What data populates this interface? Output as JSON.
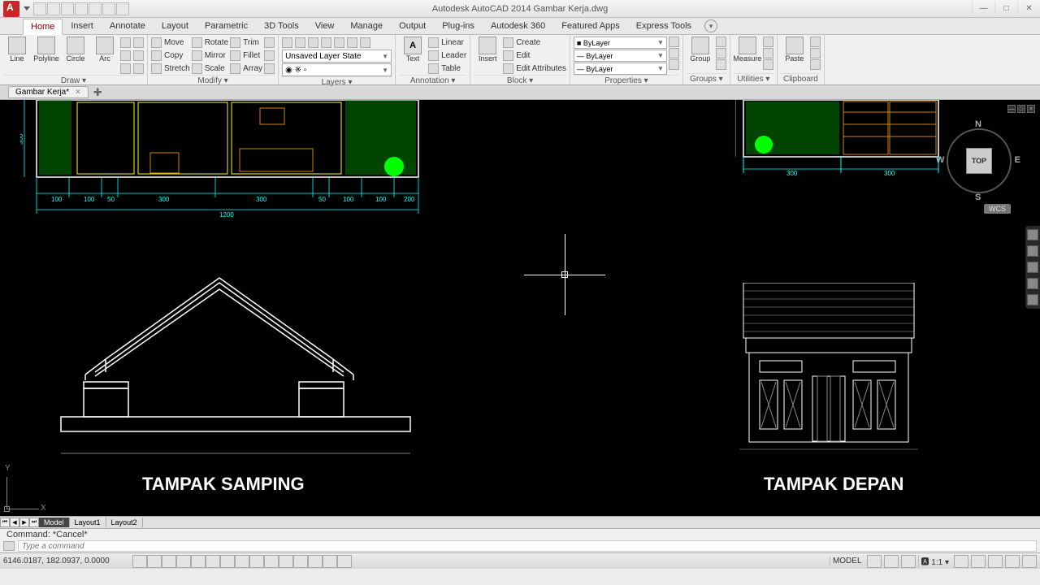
{
  "titlebar": {
    "app_title": "Autodesk AutoCAD 2014    Gambar Kerja.dwg"
  },
  "tabs": [
    "Home",
    "Insert",
    "Annotate",
    "Layout",
    "Parametric",
    "3D Tools",
    "View",
    "Manage",
    "Output",
    "Plug-ins",
    "Autodesk 360",
    "Featured Apps",
    "Express Tools"
  ],
  "active_tab": "Home",
  "ribbon": {
    "draw": {
      "title": "Draw ▾",
      "line": "Line",
      "polyline": "Polyline",
      "circle": "Circle",
      "arc": "Arc"
    },
    "modify": {
      "title": "Modify ▾",
      "move": "Move",
      "rotate": "Rotate",
      "trim": "Trim",
      "copy": "Copy",
      "mirror": "Mirror",
      "fillet": "Fillet",
      "stretch": "Stretch",
      "scale": "Scale",
      "array": "Array"
    },
    "layers": {
      "title": "Layers ▾",
      "state": "Unsaved Layer State"
    },
    "annotation": {
      "title": "Annotation ▾",
      "text": "Text",
      "linear": "Linear",
      "leader": "Leader",
      "table": "Table"
    },
    "block": {
      "title": "Block ▾",
      "insert": "Insert",
      "create": "Create",
      "edit": "Edit",
      "attrs": "Edit Attributes"
    },
    "properties": {
      "title": "Properties ▾",
      "bylayer": "ByLayer"
    },
    "groups": {
      "title": "Groups ▾",
      "group": "Group"
    },
    "utilities": {
      "title": "Utilities ▾",
      "measure": "Measure"
    },
    "clipboard": {
      "title": "Clipboard",
      "paste": "Paste"
    }
  },
  "file_tab": "Gambar Kerja*",
  "canvas": {
    "label_side": "TAMPAK SAMPING",
    "label_front": "TAMPAK DEPAN",
    "viewcube_top": "TOP",
    "wcs": "WCS",
    "dims_bottom": [
      "100",
      "100",
      "50",
      "300",
      "300",
      "50",
      "100",
      "100",
      "200"
    ],
    "dim_total": "1200",
    "dim_side": "300",
    "dims_right": [
      "300",
      "300"
    ]
  },
  "layout_tabs": [
    "Model",
    "Layout1",
    "Layout2"
  ],
  "cmd": {
    "history": "Command: *Cancel*",
    "placeholder": "Type a command"
  },
  "status": {
    "coords": "6146.0187, 182.0937, 0.0000",
    "model": "MODEL",
    "scale": "1:1"
  }
}
